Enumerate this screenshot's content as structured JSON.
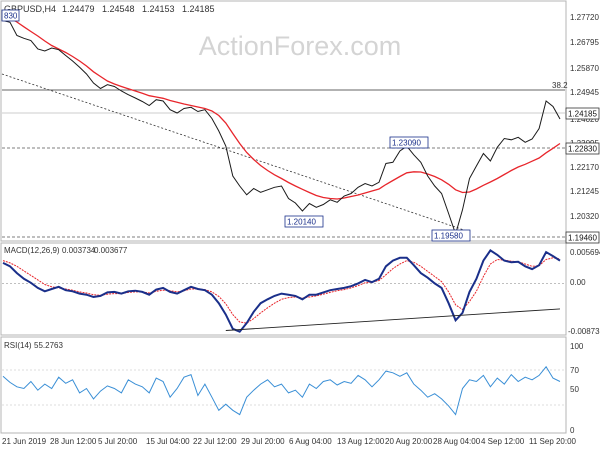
{
  "chart_data": {
    "type": "line",
    "symbol": "GBPUSD,H4",
    "ohlc_header": [
      "1.24479",
      "1.24548",
      "1.24153",
      "1.24185"
    ],
    "watermark": "ActionForex.com",
    "x_tick_labels": [
      "21 Jun 2019",
      "28 Jun 12:00",
      "5 Jul 20:00",
      "15 Jul 04:00",
      "22 Jul 12:00",
      "29 Jul 20:00",
      "6 Aug 04:00",
      "13 Aug 12:00",
      "20 Aug 20:00",
      "28 Aug 04:00",
      "4 Sep 12:00",
      "11 Sep 20:00"
    ],
    "price_panel": {
      "y_tick_labels": [
        "1.27720",
        "1.26795",
        "1.25870",
        "1.24945",
        "1.24020",
        "1.23095",
        "1.22170",
        "1.21245",
        "1.20320"
      ],
      "ylim": [
        1.1946,
        1.2842
      ],
      "level_labels": [
        "1.24185",
        "1.22830",
        "1.19460"
      ],
      "annotations": [
        "830",
        "38.2",
        "1.23090",
        "1.20140",
        "1.19580"
      ],
      "series": [
        {
          "name": "price",
          "values": [
            1.2812,
            1.2805,
            1.2752,
            1.2741,
            1.2732,
            1.2698,
            1.269,
            1.2702,
            1.2695,
            1.2672,
            1.265,
            1.2625,
            1.2598,
            1.2562,
            1.254,
            1.2555,
            1.2548,
            1.253,
            1.2515,
            1.2502,
            1.2488,
            1.2472,
            1.2495,
            1.249,
            1.2455,
            1.2442,
            1.246,
            1.2465,
            1.2448,
            1.2455,
            1.242,
            1.237,
            1.231,
            1.219,
            1.215,
            1.2115,
            1.214,
            1.2125,
            1.2135,
            1.2145,
            1.215,
            1.21,
            1.2082,
            1.205,
            1.208,
            1.2065,
            1.2076,
            1.2095,
            1.2085,
            1.211,
            1.212,
            1.2145,
            1.216,
            1.215,
            1.2165,
            1.224,
            1.2245,
            1.229,
            1.2309,
            1.2275,
            1.2245,
            1.219,
            1.215,
            1.212,
            1.204,
            1.1958,
            1.2055,
            1.218,
            1.223,
            1.228,
            1.225,
            1.2305,
            1.234,
            1.2335,
            1.2345,
            1.2325,
            1.2338,
            1.238,
            1.249,
            1.2468,
            1.2418
          ]
        },
        {
          "name": "ma",
          "values": [
            1.283,
            1.2822,
            1.2806,
            1.2787,
            1.2768,
            1.275,
            1.273,
            1.2712,
            1.2698,
            1.2684,
            1.2668,
            1.265,
            1.263,
            1.2607,
            1.2588,
            1.257,
            1.2558,
            1.2548,
            1.2539,
            1.253,
            1.2521,
            1.2511,
            1.2506,
            1.2501,
            1.2492,
            1.2485,
            1.2478,
            1.2472,
            1.2466,
            1.246,
            1.245,
            1.2432,
            1.2402,
            1.236,
            1.232,
            1.2284,
            1.2256,
            1.2232,
            1.2212,
            1.2195,
            1.218,
            1.2164,
            1.215,
            1.2137,
            1.2124,
            1.2112,
            1.2104,
            1.21,
            1.2098,
            1.2102,
            1.2108,
            1.2114,
            1.2122,
            1.213,
            1.2138,
            1.2156,
            1.2172,
            1.2188,
            1.2203,
            1.2207,
            1.2206,
            1.2198,
            1.2188,
            1.2175,
            1.2157,
            1.2135,
            1.2124,
            1.2126,
            1.2138,
            1.2153,
            1.2166,
            1.218,
            1.2196,
            1.2212,
            1.2226,
            1.2237,
            1.2249,
            1.2262,
            1.2283,
            1.2301,
            1.232
          ]
        }
      ]
    },
    "macd_panel": {
      "label": "MACD(12,26,9)",
      "values_header": [
        "0.003734",
        "0.003677"
      ],
      "y_tick_labels": [
        "0.005694",
        "0.00",
        "-0.008737"
      ],
      "ylim": [
        -0.008737,
        0.005694
      ],
      "series": [
        {
          "name": "macd",
          "values": [
            0.0036,
            0.003,
            0.0018,
            0.0008,
            0.0001,
            -0.0008,
            -0.0014,
            -0.001,
            -0.0006,
            -0.0012,
            -0.0014,
            -0.0018,
            -0.002,
            -0.0024,
            -0.0022,
            -0.0016,
            -0.0015,
            -0.0018,
            -0.0014,
            -0.0013,
            -0.0015,
            -0.002,
            -0.0011,
            -0.0008,
            -0.0015,
            -0.0018,
            -0.0012,
            -0.0006,
            -0.001,
            -0.0012,
            -0.002,
            -0.0035,
            -0.0055,
            -0.008,
            -0.0085,
            -0.007,
            -0.005,
            -0.0035,
            -0.0028,
            -0.0022,
            -0.0018,
            -0.002,
            -0.0022,
            -0.0028,
            -0.002,
            -0.002,
            -0.0016,
            -0.0012,
            -0.001,
            -0.0008,
            -0.0005,
            0.0,
            0.0006,
            0.0002,
            0.0008,
            0.003,
            0.004,
            0.0045,
            0.0045,
            0.0032,
            0.0018,
            0.001,
            0.0,
            -0.0008,
            -0.0035,
            -0.0065,
            -0.0052,
            -0.0015,
            0.0008,
            0.004,
            0.0058,
            0.005,
            0.004,
            0.0037,
            0.0038,
            0.003,
            0.0025,
            0.0032,
            0.0055,
            0.0048,
            0.004
          ]
        },
        {
          "name": "signal",
          "values": [
            0.004,
            0.0036,
            0.003,
            0.0022,
            0.0014,
            0.0006,
            -0.0002,
            -0.0006,
            -0.0008,
            -0.001,
            -0.0012,
            -0.0015,
            -0.0017,
            -0.002,
            -0.0021,
            -0.0019,
            -0.0018,
            -0.0018,
            -0.0016,
            -0.0015,
            -0.0015,
            -0.0017,
            -0.0014,
            -0.0012,
            -0.0013,
            -0.0015,
            -0.0013,
            -0.001,
            -0.001,
            -0.0011,
            -0.0015,
            -0.0023,
            -0.0036,
            -0.0055,
            -0.0068,
            -0.007,
            -0.0062,
            -0.0052,
            -0.0043,
            -0.0035,
            -0.0028,
            -0.0025,
            -0.0024,
            -0.0026,
            -0.0024,
            -0.0022,
            -0.0019,
            -0.0016,
            -0.0013,
            -0.0011,
            -0.0008,
            -0.0004,
            0.0001,
            0.0002,
            0.0005,
            0.0015,
            0.0026,
            0.0034,
            0.004,
            0.0037,
            0.003,
            0.0021,
            0.0012,
            0.0003,
            -0.0015,
            -0.0038,
            -0.0046,
            -0.0032,
            -0.0014,
            0.0012,
            0.0034,
            0.0042,
            0.0041,
            0.0039,
            0.0038,
            0.0034,
            0.003,
            0.0031,
            0.0042,
            0.0045,
            0.0043
          ]
        }
      ],
      "trendline": [
        [
          32,
          -0.0083
        ],
        [
          80,
          -0.0045
        ]
      ]
    },
    "rsi_panel": {
      "label": "RSI(14)",
      "value_header": "55.2763",
      "y_tick_labels": [
        "100",
        "70",
        "50",
        "0"
      ],
      "ylim": [
        0,
        100
      ],
      "series": [
        {
          "name": "rsi",
          "values": [
            64,
            57,
            52,
            50,
            58,
            48,
            55,
            50,
            63,
            56,
            60,
            45,
            50,
            38,
            47,
            53,
            50,
            45,
            60,
            55,
            52,
            45,
            62,
            58,
            40,
            50,
            63,
            66,
            42,
            55,
            40,
            25,
            32,
            25,
            20,
            40,
            48,
            55,
            60,
            52,
            55,
            45,
            48,
            40,
            55,
            50,
            58,
            60,
            54,
            58,
            56,
            65,
            60,
            52,
            60,
            70,
            68,
            64,
            68,
            55,
            48,
            40,
            44,
            38,
            30,
            20,
            50,
            60,
            58,
            65,
            52,
            62,
            55,
            66,
            58,
            63,
            60,
            65,
            75,
            62,
            58
          ]
        }
      ]
    }
  }
}
